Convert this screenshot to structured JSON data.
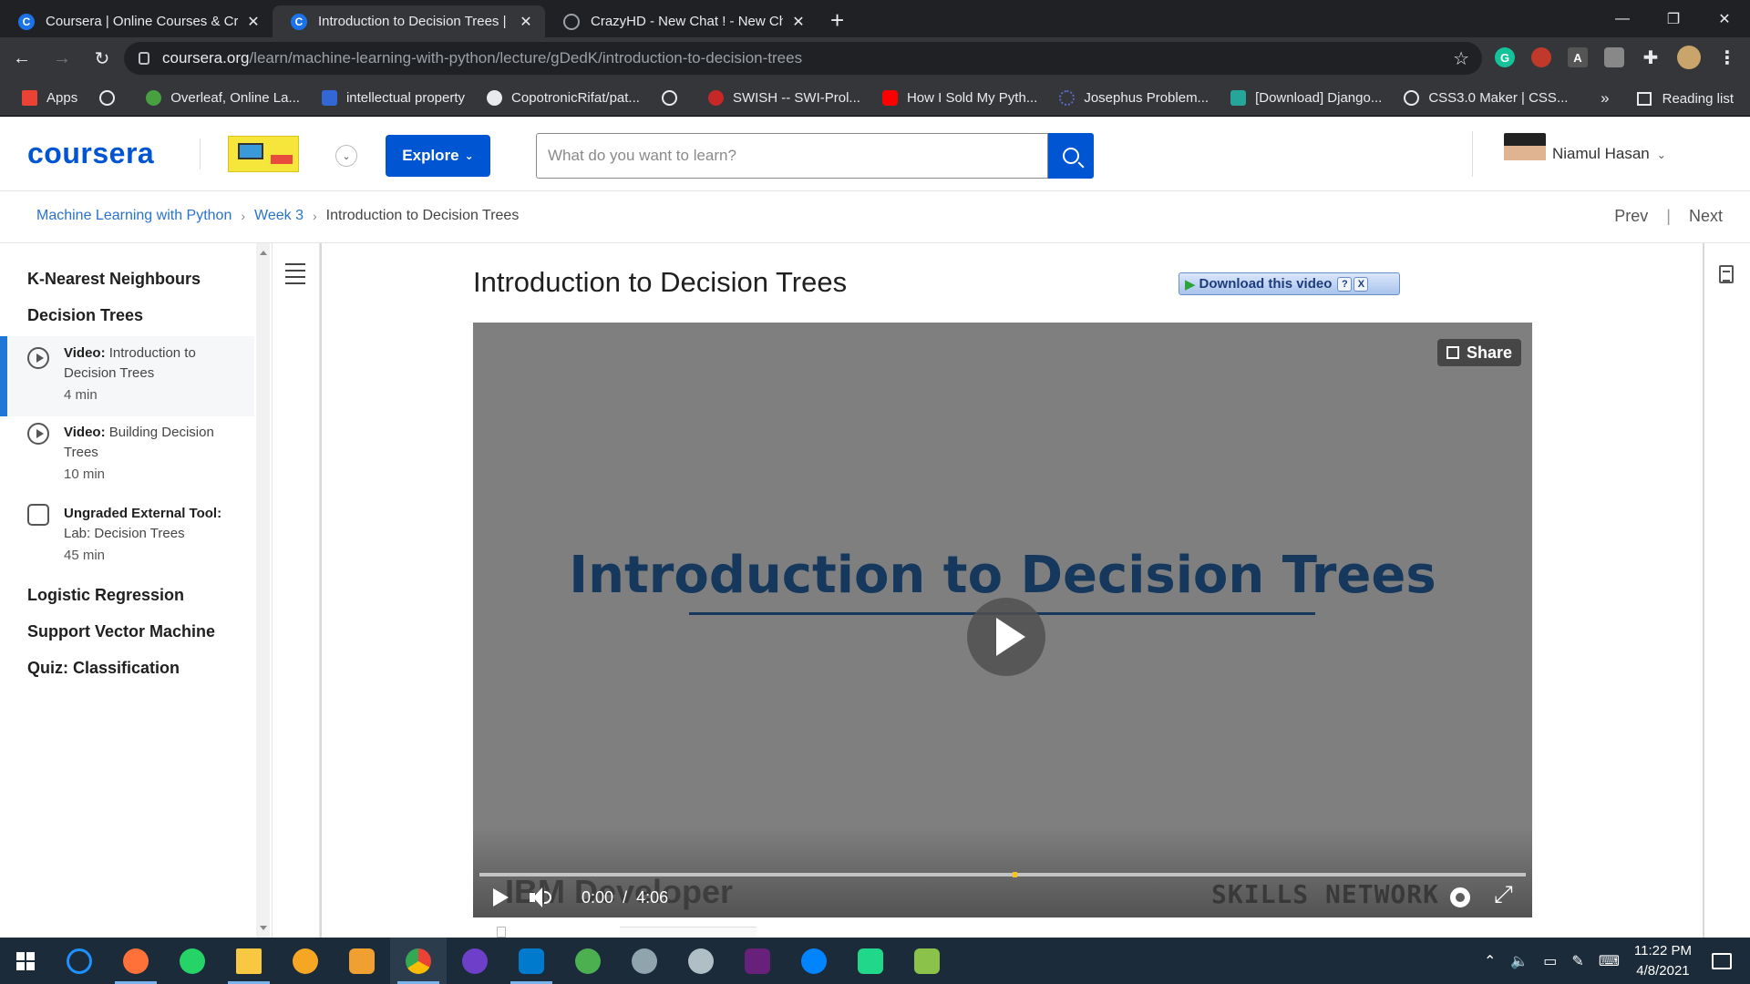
{
  "browser": {
    "tabs": [
      {
        "title": "Coursera | Online Courses & Cred",
        "icon": "coursera-favicon"
      },
      {
        "title": "Introduction to Decision Trees | C",
        "icon": "coursera-favicon"
      },
      {
        "title": "CrazyHD - New Chat ! - New Cha",
        "icon": "globe-icon"
      }
    ],
    "new_tab": "+",
    "address": {
      "domain": "coursera.org",
      "path": "/learn/machine-learning-with-python/lecture/gDedK/introduction-to-decision-trees"
    },
    "bookmarks": [
      {
        "label": "Apps",
        "color": "#ea4335"
      },
      {
        "label": "",
        "color": "#9aa0a6"
      },
      {
        "label": "Overleaf, Online La...",
        "color": "#47a141"
      },
      {
        "label": "intellectual property",
        "color": "#3367d6"
      },
      {
        "label": "CopotronicRifat/pat...",
        "color": "#e8eaed"
      },
      {
        "label": "",
        "color": "#9aa0a6"
      },
      {
        "label": "SWISH -- SWI-Prol...",
        "color": "#c62828"
      },
      {
        "label": "How I Sold My Pyth...",
        "color": "#ff0000"
      },
      {
        "label": "Josephus Problem...",
        "color": "#3f51b5"
      },
      {
        "label": "[Download] Django...",
        "color": "#26a69a"
      },
      {
        "label": "CSS3.0 Maker | CSS...",
        "color": "#9aa0a6"
      }
    ],
    "bookmarks_more": "»",
    "reading_list": "Reading list"
  },
  "header": {
    "logo": "coursera",
    "explore": "Explore",
    "search_placeholder": "What do you want to learn?",
    "user_name": "Niamul Hasan"
  },
  "breadcrumb": {
    "course": "Machine Learning with Python",
    "week": "Week 3",
    "current": "Introduction to Decision Trees",
    "sep": "›"
  },
  "nav": {
    "prev": "Prev",
    "sep": "|",
    "next": "Next"
  },
  "sidebar": {
    "sections": [
      "K-Nearest Neighbours",
      "Decision Trees",
      "Logistic Regression",
      "Support Vector Machine",
      "Quiz: Classification"
    ],
    "items": [
      {
        "type": "Video:",
        "title": "Introduction to Decision Trees",
        "duration": "4 min"
      },
      {
        "type": "Video:",
        "title": "Building Decision Trees",
        "duration": "10 min"
      },
      {
        "type": "Ungraded External Tool:",
        "title": "Lab: Decision Trees",
        "duration": "45 min"
      }
    ]
  },
  "main": {
    "title": "Introduction to Decision Trees",
    "download_ext": "Download this video",
    "download_help": "?",
    "download_close": "X"
  },
  "video": {
    "share": "Share",
    "slide_title": "Introduction to Decision Trees",
    "watermark_left": "IBM Developer",
    "watermark_right": "SKILLS NETWORK",
    "current_time": "0:00",
    "time_sep": "/",
    "duration": "4:06"
  },
  "taskbar": {
    "time": "11:22 PM",
    "date": "4/8/2021"
  }
}
